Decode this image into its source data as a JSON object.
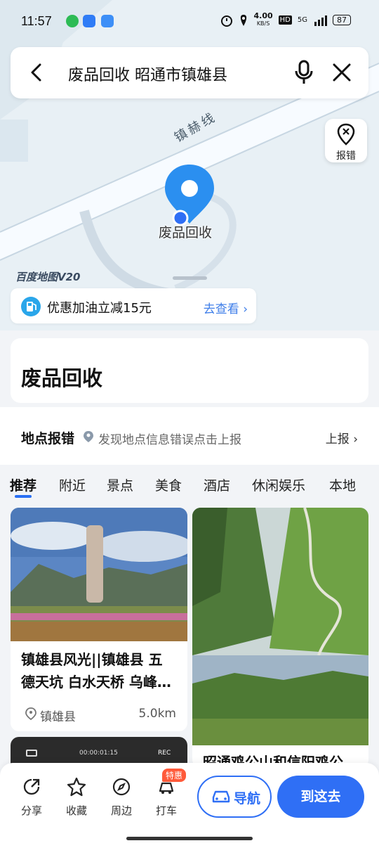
{
  "status_bar": {
    "time": "11:57",
    "network_speed": "4.00",
    "network_unit": "KB/S",
    "hd": "HD",
    "signal": "5G",
    "battery": "87"
  },
  "search": {
    "query": "废品回收 昭通市镇雄县"
  },
  "map": {
    "road_name": "镇赫线",
    "pin_label": "废品回收",
    "report_button_label": "报错",
    "watermark": "百度地图V20",
    "colors": {
      "pin": "#2b8ff0",
      "road": "#f7fbff",
      "background": "#e8f0f5"
    }
  },
  "promo": {
    "text": "优惠加油立减15元",
    "link_label": "去查看",
    "icon": "gas-pump-icon"
  },
  "place": {
    "title": "废品回收"
  },
  "report_row": {
    "title": "地点报错",
    "hint": "发现地点信息错误点击上报",
    "action_label": "上报"
  },
  "tabs": [
    {
      "label": "推荐",
      "active": true
    },
    {
      "label": "附近",
      "active": false
    },
    {
      "label": "景点",
      "active": false
    },
    {
      "label": "美食",
      "active": false
    },
    {
      "label": "酒店",
      "active": false
    },
    {
      "label": "休闲娱乐",
      "active": false
    },
    {
      "label": "本地",
      "active": false
    }
  ],
  "feed": {
    "cards": [
      {
        "title_line1": "镇雄县风光||镇雄县 五",
        "title_line2": "德天坑 白水天桥 乌峰…",
        "location": "镇雄县",
        "distance": "5.0km"
      },
      {
        "title_line1": "昭通鸡公山和信阳鸡公"
      }
    ],
    "video_time": "00:00:01:15",
    "video_rec": "REC"
  },
  "bottom_bar": {
    "share_label": "分享",
    "favorite_label": "收藏",
    "nearby_label": "周边",
    "taxi_label": "打车",
    "taxi_badge": "特惠",
    "navigate_label": "导航",
    "go_label": "到这去",
    "accent_color": "#2f6ff5"
  }
}
